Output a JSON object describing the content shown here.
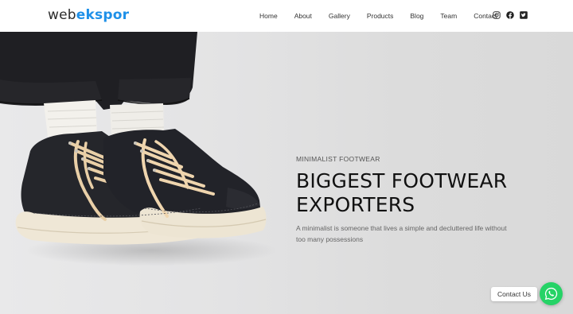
{
  "brand": {
    "part1": "web",
    "part2": "ekspor"
  },
  "nav": {
    "items": [
      "Home",
      "About",
      "Gallery",
      "Products",
      "Blog",
      "Team",
      "Contact"
    ]
  },
  "socials": [
    "instagram-icon",
    "facebook-icon",
    "twitter-icon"
  ],
  "hero": {
    "kicker": "MINIMALIST FOOTWEAR",
    "headline_line1": "BIGGEST FOOTWEAR",
    "headline_line2": "EXPORTERS",
    "subtext": "A minimalist is someone that lives a simple and decluttered life without too many possessions"
  },
  "contact": {
    "label": "Contact Us",
    "icon": "whatsapp-icon"
  },
  "colors": {
    "brand_accent": "#1e90e8",
    "whatsapp": "#25d366",
    "hero_bg": "#e0e0e0"
  }
}
